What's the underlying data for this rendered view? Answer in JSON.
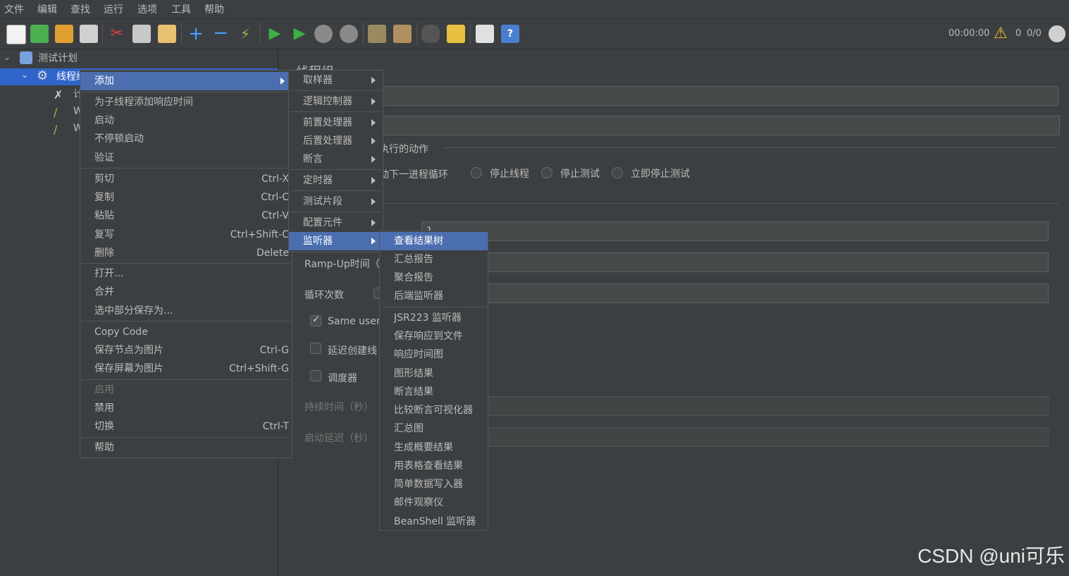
{
  "menubar": [
    "文件",
    "编辑",
    "查找",
    "运行",
    "选项",
    "工具",
    "帮助"
  ],
  "toolbar": {
    "timer": "00:00:00",
    "warn_count": "0",
    "threads": "0/0"
  },
  "tree": {
    "root": "测试计划",
    "thread_group": "线程组",
    "children": [
      "计",
      "W",
      "W"
    ]
  },
  "right": {
    "title": "线程组",
    "section_action": "执行的动作",
    "radio_next_loop": "动下一进程循环",
    "radio_stop_thread": "停止线程",
    "radio_stop_test": "停止测试",
    "radio_stop_now": "立即停止测试",
    "ramp_label": "Ramp-Up时间（",
    "loop_label": "循环次数",
    "same_user": "Same user",
    "delay_create": "延迟创建线",
    "scheduler": "调度器",
    "duration": "持续时间（秒）",
    "startup_delay": "启动延迟（秒）",
    "thread_count_value": "1"
  },
  "context_menu": {
    "add": "添加",
    "add_response_time": "为子线程添加响应时间",
    "start": "启动",
    "start_no_pause": "不停顿启动",
    "validate": "验证",
    "cut": "剪切",
    "cut_sc": "Ctrl-X",
    "copy": "复制",
    "copy_sc": "Ctrl-C",
    "paste": "粘贴",
    "paste_sc": "Ctrl-V",
    "duplicate": "复写",
    "duplicate_sc": "Ctrl+Shift-C",
    "delete": "删除",
    "delete_sc": "Delete",
    "open": "打开...",
    "merge": "合并",
    "save_selection": "选中部分保存为...",
    "copy_code": "Copy Code",
    "save_node_img": "保存节点为图片",
    "save_node_img_sc": "Ctrl-G",
    "save_screen_img": "保存屏幕为图片",
    "save_screen_img_sc": "Ctrl+Shift-G",
    "enable": "启用",
    "disable": "禁用",
    "toggle": "切换",
    "toggle_sc": "Ctrl-T",
    "help": "帮助"
  },
  "add_submenu": [
    "取样器",
    "逻辑控制器",
    "前置处理器",
    "后置处理器",
    "断言",
    "定时器",
    "测试片段",
    "配置元件",
    "监听器"
  ],
  "listener_submenu": [
    "查看结果树",
    "汇总报告",
    "聚合报告",
    "后端监听器",
    "JSR223 监听器",
    "保存响应到文件",
    "响应时间图",
    "图形结果",
    "断言结果",
    "比较断言可视化器",
    "汇总图",
    "生成概要结果",
    "用表格查看结果",
    "简单数据写入器",
    "邮件观察仪",
    "BeanShell 监听器"
  ],
  "watermark": "CSDN @uni可乐"
}
